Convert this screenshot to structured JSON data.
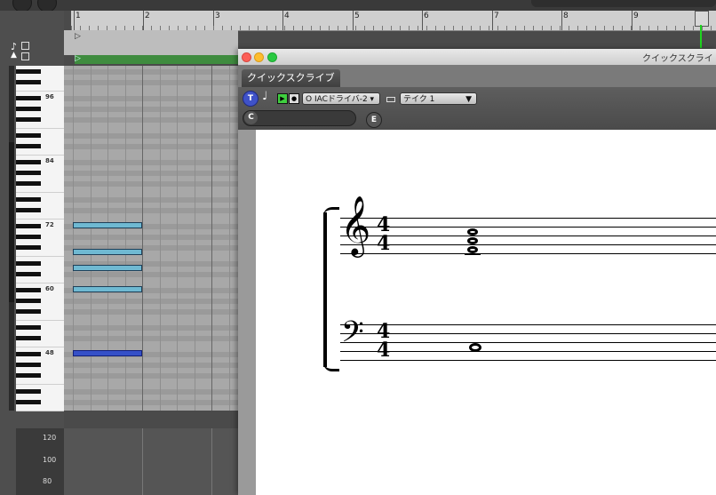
{
  "ruler": {
    "bars": [
      "1",
      "2",
      "3",
      "4",
      "5",
      "6",
      "7",
      "8",
      "9"
    ]
  },
  "piano": {
    "labels": [
      "96",
      "84",
      "72",
      "60",
      "48"
    ]
  },
  "velocity": {
    "labels": [
      "120",
      "100",
      "80"
    ]
  },
  "window": {
    "title": "クイックスクライ",
    "tab": "クイックスクライブ",
    "toolbar": {
      "t_label": "T",
      "midi_port": "O IACドライバ-2",
      "take": "テイク 1",
      "c_label": "C",
      "e_label": "E"
    }
  },
  "score": {
    "treble_time": {
      "num": "4",
      "den": "4"
    },
    "bass_time": {
      "num": "4",
      "den": "4"
    },
    "treble_clef": "𝄞",
    "bass_clef": "𝄢"
  },
  "colors": {
    "note_light": "#6fb9d2",
    "note_selected": "#3550c8",
    "region": "#3f8c3f"
  }
}
